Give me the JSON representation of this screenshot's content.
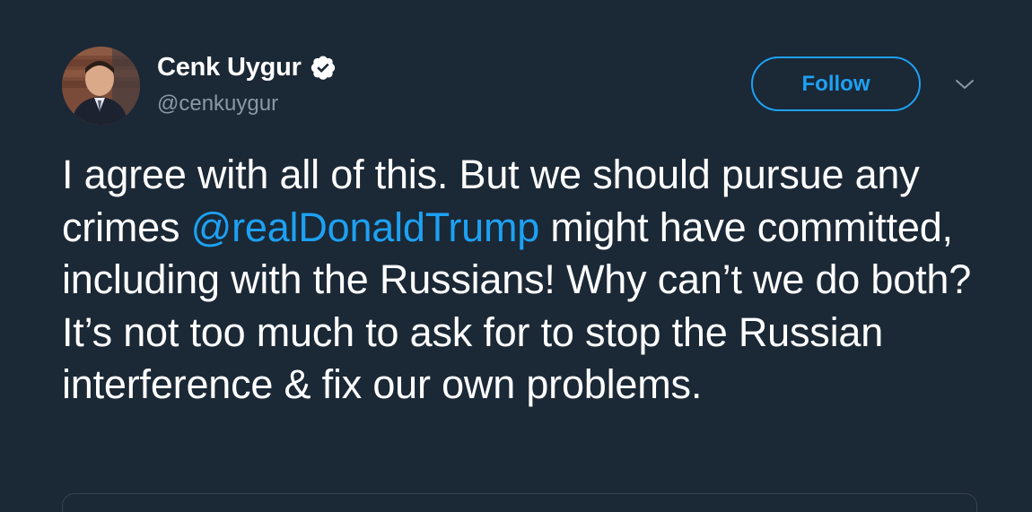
{
  "author": {
    "display_name": "Cenk Uygur",
    "handle": "@cenkuygur",
    "verified": true
  },
  "actions": {
    "follow_label": "Follow",
    "more_icon": "chevron-down-icon"
  },
  "tweet": {
    "text_before": "I agree with all of this. But we should pursue any crimes ",
    "mention": "@realDonaldTrump",
    "text_after": " might have committed, including with the Russians! Why can’t we do both? It’s not too much to ask for to stop the Russian interference & fix our own problems."
  },
  "colors": {
    "background": "#1b2836",
    "accent": "#1da1f2",
    "secondary_text": "#8899a6"
  }
}
